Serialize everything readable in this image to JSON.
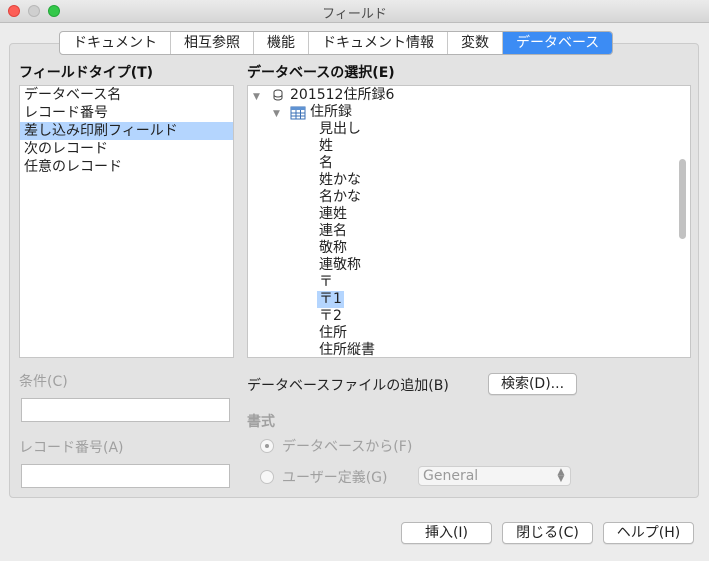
{
  "window": {
    "title": "フィールド"
  },
  "tabs": [
    {
      "label": "ドキュメント",
      "active": false
    },
    {
      "label": "相互参照",
      "active": false
    },
    {
      "label": "機能",
      "active": false
    },
    {
      "label": "ドキュメント情報",
      "active": false
    },
    {
      "label": "変数",
      "active": false
    },
    {
      "label": "データベース",
      "active": true
    }
  ],
  "field_type": {
    "label": "フィールドタイプ(T)",
    "items": [
      {
        "label": "データベース名",
        "selected": false
      },
      {
        "label": "レコード番号",
        "selected": false
      },
      {
        "label": "差し込み印刷フィールド",
        "selected": true
      },
      {
        "label": "次のレコード",
        "selected": false
      },
      {
        "label": "任意のレコード",
        "selected": false
      }
    ]
  },
  "condition": {
    "label": "条件(C)",
    "value": ""
  },
  "record_number": {
    "label": "レコード番号(A)",
    "value": ""
  },
  "database_select": {
    "label": "データベースの選択(E)",
    "root": "201512住所録6",
    "table": "住所録",
    "fields": [
      "見出し",
      "姓",
      "名",
      "姓かな",
      "名かな",
      "連姓",
      "連名",
      "敬称",
      "連敬称",
      "〒",
      "〒1",
      "〒2",
      "住所",
      "住所縦書"
    ],
    "selected_field": "〒1"
  },
  "add_db_file": {
    "label": "データベースファイルの追加(B)",
    "browse_button": "検索(D)..."
  },
  "format": {
    "label": "書式",
    "from_database": "データベースから(F)",
    "user_defined": "ユーザー定義(G)",
    "format_select": "General",
    "selected_option": "from_database"
  },
  "buttons": {
    "insert": "挿入(I)",
    "close": "閉じる(C)",
    "help": "ヘルプ(H)"
  },
  "colors": {
    "accent": "#3c8cf4",
    "selection": "#b4d5fe"
  }
}
